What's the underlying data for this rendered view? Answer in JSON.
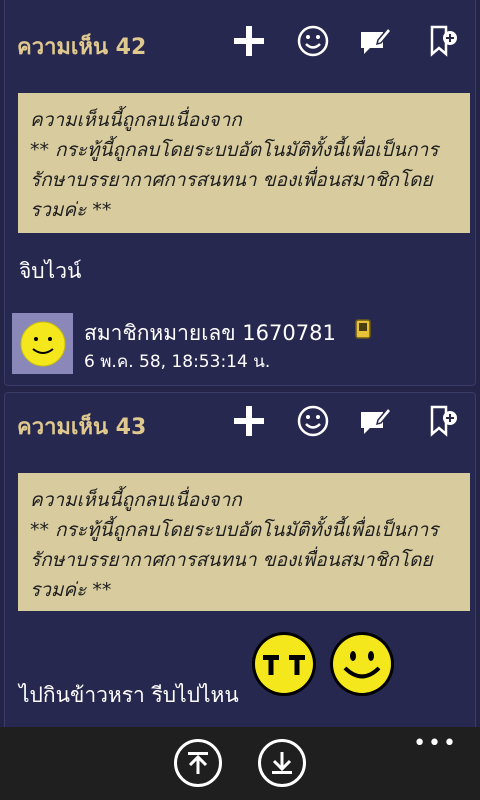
{
  "comments": [
    {
      "title": "ความเห็น 42",
      "deleted_notice": {
        "line1": "ความเห็นนี้ถูกลบเนื่องจาก",
        "line2": "** กระทู้นี้ถูกลบโดยระบบอัตโนมัติทั้งนี้เพื่อเป็นการ",
        "line3": "รักษาบรรยากาศการสนทนา ของเพื่อนสมาชิกโดย",
        "line4": "รวมค่ะ **"
      },
      "body": "จิบไวน์",
      "author": {
        "name": "สมาชิกหมายเลข 1670781",
        "date": "6 พ.ค. 58, 18:53:14 น."
      }
    },
    {
      "title": "ความเห็น 43",
      "deleted_notice": {
        "line1": "ความเห็นนี้ถูกลบเนื่องจาก",
        "line2": "** กระทู้นี้ถูกลบโดยระบบอัตโนมัติทั้งนี้เพื่อเป็นการ",
        "line3": "รักษาบรรยากาศการสนทนา ของเพื่อนสมาชิกโดย",
        "line4": "รวมค่ะ **"
      },
      "body": "ไปกินข้าวหรา  รีบไปไหน"
    }
  ],
  "appbar": {
    "more": "•••"
  },
  "colors": {
    "background": "#232448",
    "title": "#e0c98e",
    "notice_bg": "#d8cc9f"
  },
  "icons": [
    "plus-icon",
    "emoticon-icon",
    "reply-icon",
    "bookmark-add-icon",
    "scroll-top-icon",
    "scroll-down-icon"
  ]
}
